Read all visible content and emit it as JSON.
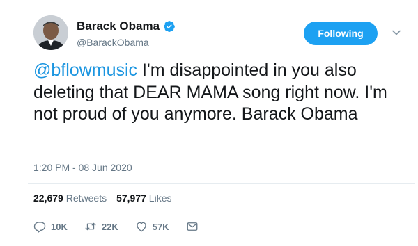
{
  "author": {
    "name": "Barack Obama",
    "handle": "@BarackObama",
    "verified_icon": "verified-badge-icon"
  },
  "follow_button": {
    "label": "Following"
  },
  "tweet": {
    "mention": "@bflowmusic",
    "text": " I'm disappointed in you also deleting that DEAR MAMA song right now. I'm not proud of you anymore. Barack Obama",
    "timestamp": "1:20 PM - 08 Jun 2020"
  },
  "stats": {
    "retweets_count": "22,679",
    "retweets_label": "Retweets",
    "likes_count": "57,977",
    "likes_label": "Likes"
  },
  "actions": {
    "reply_count": "10K",
    "retweet_count": "22K",
    "like_count": "57K"
  },
  "colors": {
    "accent": "#1da1f2",
    "link": "#1b95e0",
    "muted": "#657786"
  }
}
